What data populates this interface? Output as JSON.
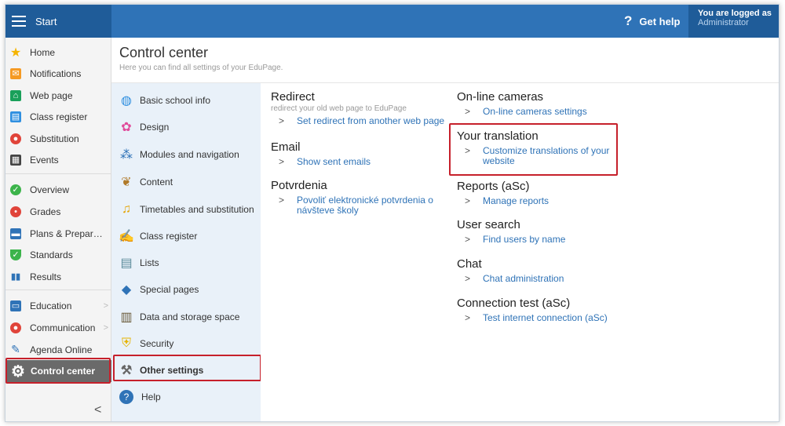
{
  "topbar": {
    "start_label": "Start",
    "help_label": "Get help",
    "logged_label": "You are logged as",
    "logged_user": "Administrator"
  },
  "nav": {
    "items": [
      {
        "label": "Home",
        "icon": "star-icon",
        "color": "#f5b400"
      },
      {
        "label": "Notifications",
        "icon": "mail-icon",
        "color": "#f59a23"
      },
      {
        "label": "Web page",
        "icon": "house-icon",
        "color": "#1aa05a"
      },
      {
        "label": "Class register",
        "icon": "book-icon",
        "color": "#2f8fe0"
      },
      {
        "label": "Substitution",
        "icon": "person-icon",
        "color": "#e0443a"
      },
      {
        "label": "Events",
        "icon": "calendar-icon",
        "color": "#444444"
      },
      {
        "label": "Overview",
        "icon": "check-circle-icon",
        "color": "#3cb44b"
      },
      {
        "label": "Grades",
        "icon": "grade-icon",
        "color": "#e0443a"
      },
      {
        "label": "Plans & Prepar…",
        "icon": "briefcase-icon",
        "color": "#2f73b7"
      },
      {
        "label": "Standards",
        "icon": "shield-check-icon",
        "color": "#3cb44b"
      },
      {
        "label": "Results",
        "icon": "bar-chart-icon",
        "color": "#2f73b7"
      },
      {
        "label": "Education",
        "icon": "open-book-icon",
        "color": "#2f73b7"
      },
      {
        "label": "Communication",
        "icon": "chat-icon",
        "color": "#e0443a"
      },
      {
        "label": "Agenda Online",
        "icon": "pen-icon",
        "color": "#2f73b7"
      },
      {
        "label": "Control center",
        "icon": "gear-icon",
        "color": "#ffffff"
      }
    ]
  },
  "page": {
    "title": "Control center",
    "subtitle": "Here you can find all settings of your EduPage."
  },
  "settings": {
    "items": [
      {
        "label": "Basic school info",
        "icon": "globe-icon"
      },
      {
        "label": "Design",
        "icon": "palette-icon"
      },
      {
        "label": "Modules and navigation",
        "icon": "modules-icon"
      },
      {
        "label": "Content",
        "icon": "content-icon"
      },
      {
        "label": "Timetables and substitution",
        "icon": "bell-icon"
      },
      {
        "label": "Class register",
        "icon": "register-icon"
      },
      {
        "label": "Lists",
        "icon": "list-icon"
      },
      {
        "label": "Special pages",
        "icon": "cube-icon"
      },
      {
        "label": "Data and storage space",
        "icon": "storage-icon"
      },
      {
        "label": "Security",
        "icon": "lock-shield-icon"
      },
      {
        "label": "Other settings",
        "icon": "tools-icon"
      },
      {
        "label": "Help",
        "icon": "help-icon"
      }
    ]
  },
  "sections": {
    "redirect": {
      "title": "Redirect",
      "desc": "redirect your old web page to EduPage",
      "link": "Set redirect from another web page"
    },
    "email": {
      "title": "Email",
      "link": "Show sent emails"
    },
    "potvrdenia": {
      "title": "Potvrdenia",
      "link": "Povoliť elektronické potvrdenia o návšteve školy"
    },
    "cameras": {
      "title": "On-line cameras",
      "link": "On-line cameras settings"
    },
    "translation": {
      "title": "Your translation",
      "link": "Customize translations of your website"
    },
    "reports": {
      "title": "Reports (aSc)",
      "link": "Manage reports"
    },
    "usersearch": {
      "title": "User search",
      "link": "Find users by name"
    },
    "chat": {
      "title": "Chat",
      "link": "Chat administration"
    },
    "conntest": {
      "title": "Connection test (aSc)",
      "link": "Test internet connection (aSc)"
    }
  },
  "arrow": ">",
  "colors": {
    "topbar": "#2f73b7",
    "topbar_dark": "#1f5c99",
    "link": "#2f73b7",
    "highlight": "#c6202b"
  }
}
